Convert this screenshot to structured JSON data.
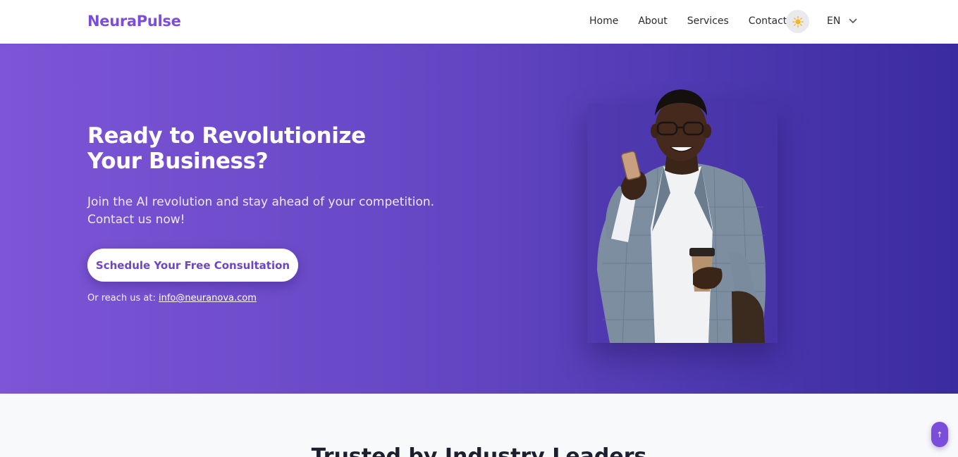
{
  "nav": {
    "brand": "NeuraPulse",
    "links": [
      "Home",
      "About",
      "Services",
      "Contact"
    ],
    "theme_icon": "sun-icon",
    "language": "EN"
  },
  "hero": {
    "title": "Ready to Revolutionize Your Business?",
    "subtitle": "Join the AI revolution and stay ahead of your competition. Contact us now!",
    "cta_label": "Schedule Your Free Consultation",
    "reach_prefix": "Or reach us at:",
    "email": "info@neuranova.com"
  },
  "trusted": {
    "title": "Trusted by Industry Leaders"
  },
  "scroll_top": {
    "icon": "arrow-up-icon",
    "glyph": "↑"
  },
  "colors": {
    "brand": "#7c4ddb",
    "hero_start": "#7d55d6",
    "hero_end": "#3b2ba0",
    "sun": "#f6b51a"
  }
}
